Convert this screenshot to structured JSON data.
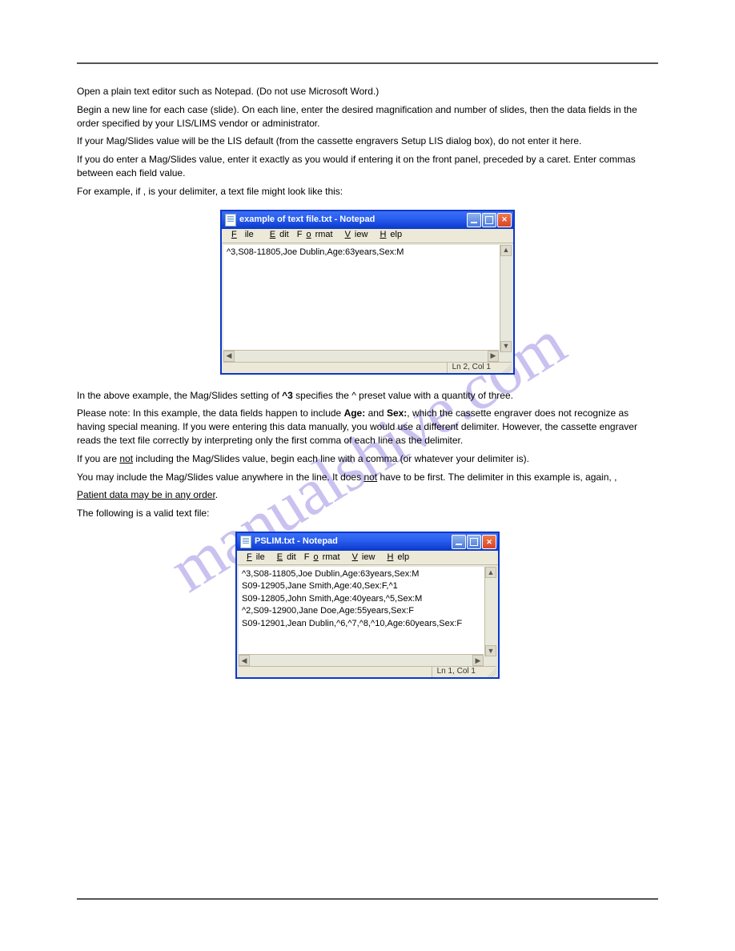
{
  "watermark": "manualshive.com",
  "paragraphs": {
    "p1": "Open a plain text editor such as Notepad. (Do not use Microsoft Word.)",
    "p2": "Begin a new line for each case (slide). On each line, enter the desired magnification and number of slides, then the data fields in the order specified by your LIS/LIMS vendor or administrator.",
    "p3": "If your Mag/Slides value will be the LIS default (from the cassette engravers Setup LIS dialog box), do not enter it here.",
    "p4": "If you do enter a Mag/Slides value, enter it exactly as you would if entering it on the front panel, preceded by a caret. Enter commas between each field value.",
    "p5_a": "For example, if ",
    "p5_b": " is your delimiter, a text file might look like this:",
    "example_delim": ",",
    "p6_pre": "In the above example, the Mag/Slides setting of ",
    "p6_magslides": "^3",
    "p6_mid": " specifies the ^ preset value with a quantity of three.",
    "p7_a": "Please note: In this example, the data fields happen to include ",
    "p7_b": " and ",
    "p7_c": ", which the cassette engraver does not recognize as having special meaning. If you were entering this data manually, you would use a different delimiter. However, the cassette engraver reads the text file correctly by interpreting only the first comma of each line as the delimiter.",
    "age_label": "Age:",
    "sex_label": "Sex:",
    "p8_a": "If you are ",
    "p8_b": " including the Mag/Slides value, begin each line with a comma (or whatever your delimiter is).",
    "p8_not": "not",
    "p9_a": "You may include the Mag/Slides value anywhere in the line. It does ",
    "p9_b": " have to be first. The delimiter in this example is, again, ",
    "p9_not": "not",
    "p9_delim": ",",
    "p10": "Patient data may be in any order",
    "p11": "The following is a valid text file:"
  },
  "notepad1": {
    "title": "example of text file.txt - Notepad",
    "menu": {
      "file": "File",
      "edit": "Edit",
      "format": "Format",
      "view": "View",
      "help": "Help"
    },
    "body": "^3,S08-11805,Joe Dublin,Age:63years,Sex:M",
    "status": "Ln 2, Col 1"
  },
  "notepad2": {
    "title": "PSLIM.txt - Notepad",
    "menu": {
      "file": "File",
      "edit": "Edit",
      "format": "Format",
      "view": "View",
      "help": "Help"
    },
    "body_lines": [
      "^3,S08-11805,Joe Dublin,Age:63years,Sex:M",
      "S09-12905,Jane Smith,Age:40,Sex:F,^1",
      "S09-12805,John Smith,Age:40years,^5,Sex:M",
      "^2,S09-12900,Jane Doe,Age:55years,Sex:F",
      "S09-12901,Jean Dublin,^6,^7,^8,^10,Age:60years,Sex:F"
    ],
    "status": "Ln 1, Col 1"
  }
}
